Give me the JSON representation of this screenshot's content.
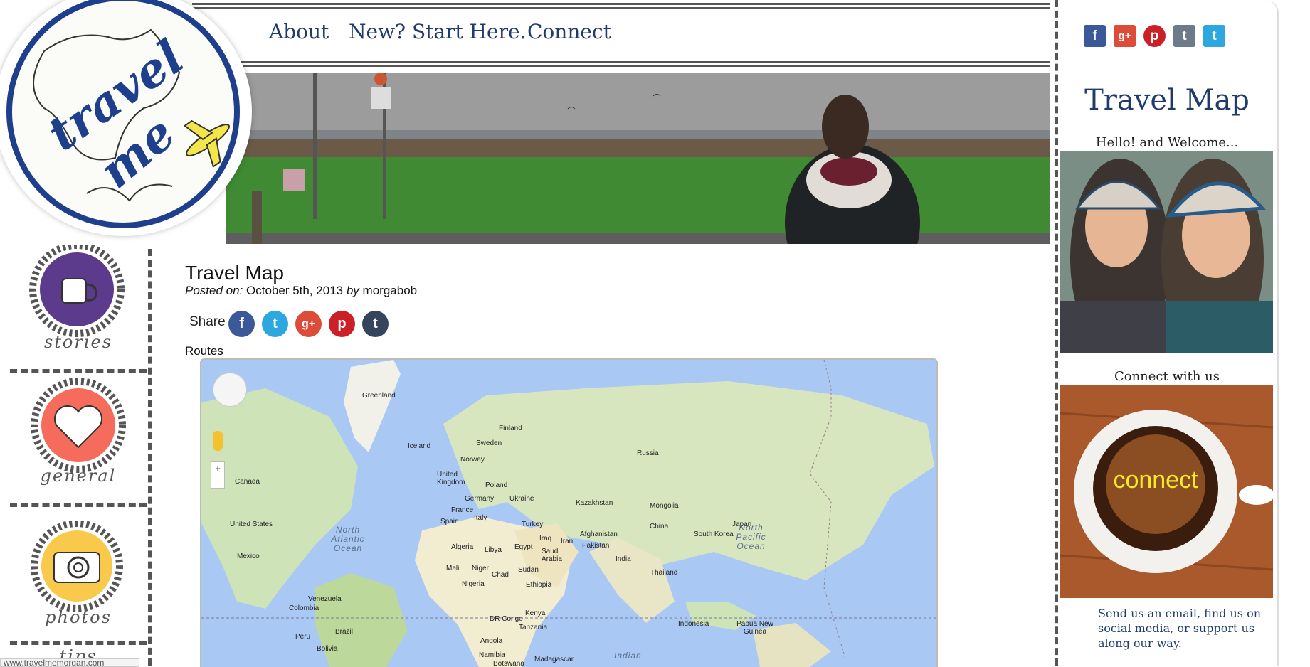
{
  "logo": {
    "text_line1": "travel",
    "text_line2": "me"
  },
  "nav": {
    "items": [
      {
        "label": "About"
      },
      {
        "label": "New? Start Here."
      },
      {
        "label": "Connect"
      }
    ]
  },
  "sidebar": {
    "categories": [
      {
        "label": "stories"
      },
      {
        "label": "general"
      },
      {
        "label": "photos"
      },
      {
        "label": "tips"
      }
    ]
  },
  "post": {
    "title": "Travel Map",
    "posted_on_label": "Posted on:",
    "date": "October 5th, 2013",
    "by_label": "by",
    "author": "morgabob",
    "share_label": "Share",
    "share_buttons": [
      "facebook-icon",
      "twitter-icon",
      "google-plus-icon",
      "pinterest-icon",
      "tumblr-icon"
    ],
    "routes_label": "Routes"
  },
  "map": {
    "zoom_in": "+",
    "zoom_out": "−",
    "countries": {
      "greenland": "Greenland",
      "iceland": "Iceland",
      "sweden": "Sweden",
      "finland": "Finland",
      "norway": "Norway",
      "russia": "Russia",
      "uk": "United Kingdom",
      "poland": "Poland",
      "germany": "Germany",
      "ukraine": "Ukraine",
      "france": "France",
      "kazakhstan": "Kazakhstan",
      "mongolia": "Mongolia",
      "spain": "Spain",
      "italy": "Italy",
      "turkey": "Turkey",
      "canada": "Canada",
      "us": "United States",
      "china": "China",
      "japan": "Japan",
      "south_korea": "South Korea",
      "iraq": "Iraq",
      "iran": "Iran",
      "afghanistan": "Afghanistan",
      "pakistan": "Pakistan",
      "algeria": "Algeria",
      "libya": "Libya",
      "egypt": "Egypt",
      "saudi": "Saudi Arabia",
      "india": "India",
      "thailand": "Thailand",
      "mexico": "Mexico",
      "mali": "Mali",
      "niger": "Niger",
      "chad": "Chad",
      "sudan": "Sudan",
      "nigeria": "Nigeria",
      "ethiopia": "Ethiopia",
      "venezuela": "Venezuela",
      "colombia": "Colombia",
      "drc": "DR Congo",
      "kenya": "Kenya",
      "tanzania": "Tanzania",
      "indonesia": "Indonesia",
      "png": "Papua New Guinea",
      "brazil": "Brazil",
      "peru": "Peru",
      "bolivia": "Bolivia",
      "angola": "Angola",
      "namibia": "Namibia",
      "madagascar": "Madagascar",
      "botswana": "Botswana"
    },
    "oceans": {
      "north_atlantic": "North Atlantic Ocean",
      "north_pacific": "North Pacific Ocean",
      "indian": "Indian"
    }
  },
  "social": [
    "facebook-icon",
    "google-plus-icon",
    "pinterest-icon",
    "tumblr-icon",
    "twitter-icon"
  ],
  "widgets": {
    "title": "Travel Map",
    "welcome": "Hello! and Welcome...",
    "connect_heading": "Connect with us",
    "connect_overlay": "connect",
    "connect_text": "Send us an email, find us on social media, or support us along our way."
  },
  "status_bar": "www.travelmemorgan.com",
  "colors": {
    "brand": "#1f3a6d",
    "facebook": "#3b5998",
    "twitter": "#2da7e0",
    "google": "#dd4b39",
    "pinterest": "#cb2027",
    "tumblr": "#35465c"
  }
}
